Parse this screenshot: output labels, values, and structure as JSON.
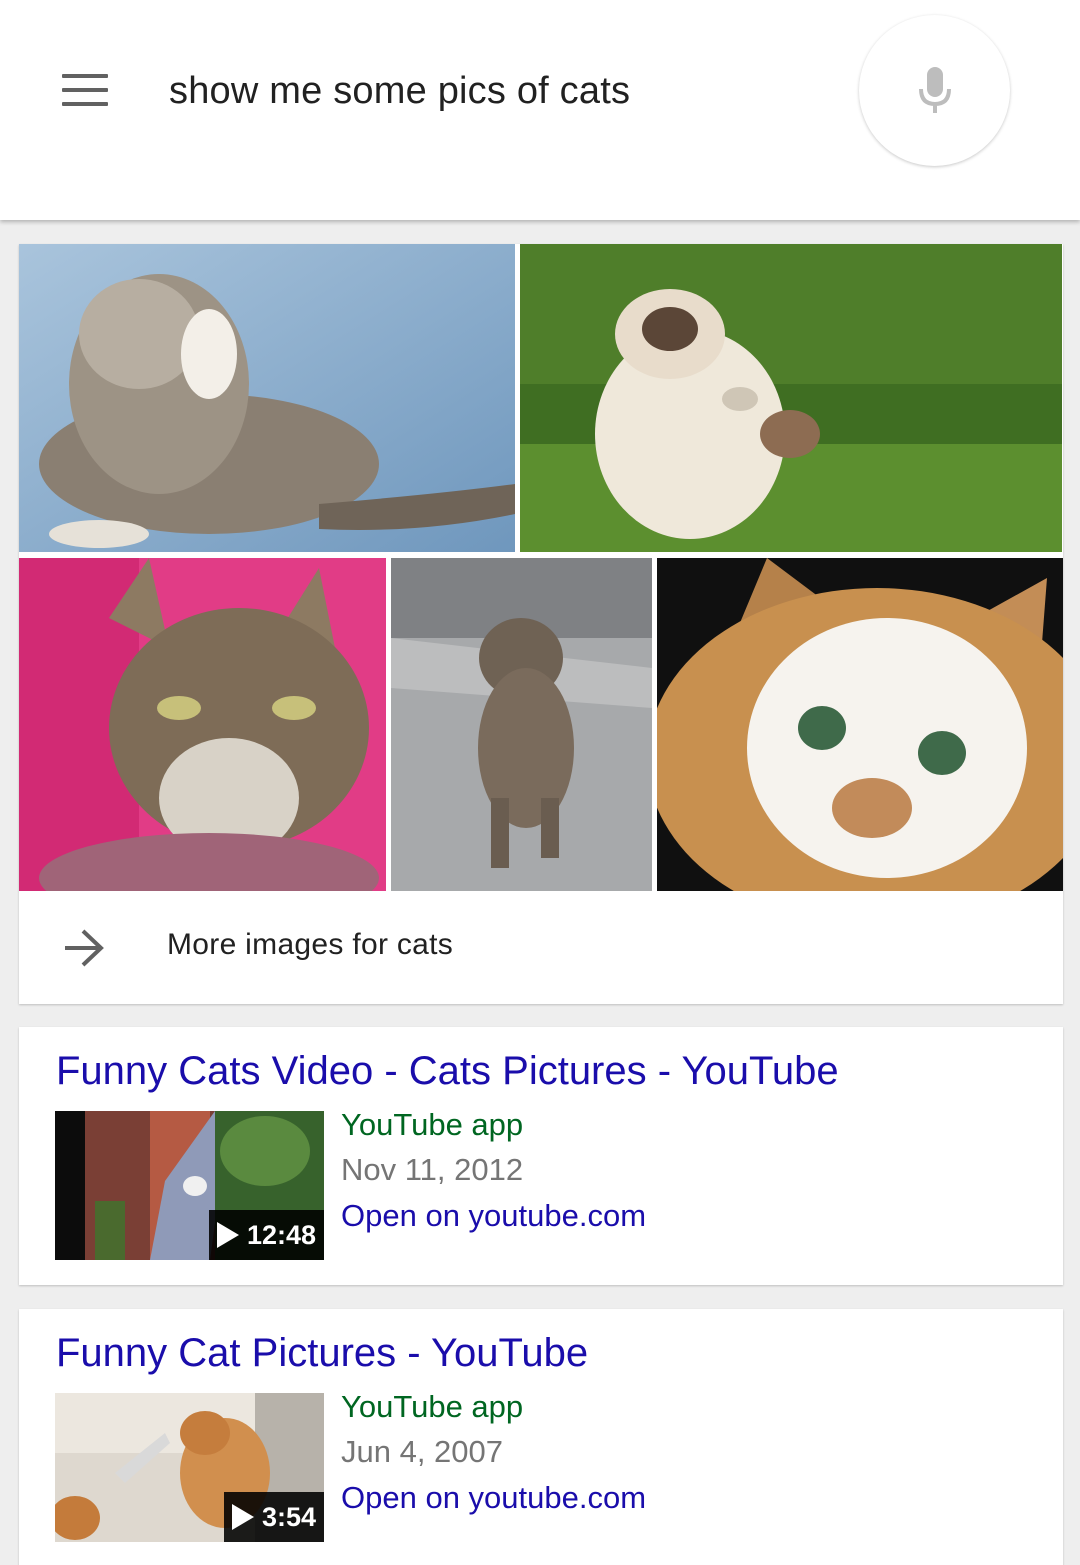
{
  "search": {
    "query": "show me some pics of cats"
  },
  "image_pack": {
    "more_label": "More images for cats",
    "images": [
      {
        "subject": "tabby cat grooming on blue background"
      },
      {
        "subject": "himalayan cat with toy on grass"
      },
      {
        "subject": "grumpy tabby cat on pink background"
      },
      {
        "subject": "tabby cat walking on pavement"
      },
      {
        "subject": "calico cat close-up on black"
      }
    ]
  },
  "results": [
    {
      "title": "Funny Cats Video - Cats Pictures - YouTube",
      "source": "YouTube app",
      "date": "Nov 11, 2012",
      "open_label": "Open on youtube.com",
      "duration": "12:48"
    },
    {
      "title": "Funny Cat Pictures - YouTube",
      "source": "YouTube app",
      "date": "Jun 4, 2007",
      "open_label": "Open on youtube.com",
      "duration": "3:54"
    }
  ],
  "colors": {
    "link": "#1a0dab",
    "source": "#006621",
    "meta": "#757575",
    "background": "#eeeeee"
  }
}
